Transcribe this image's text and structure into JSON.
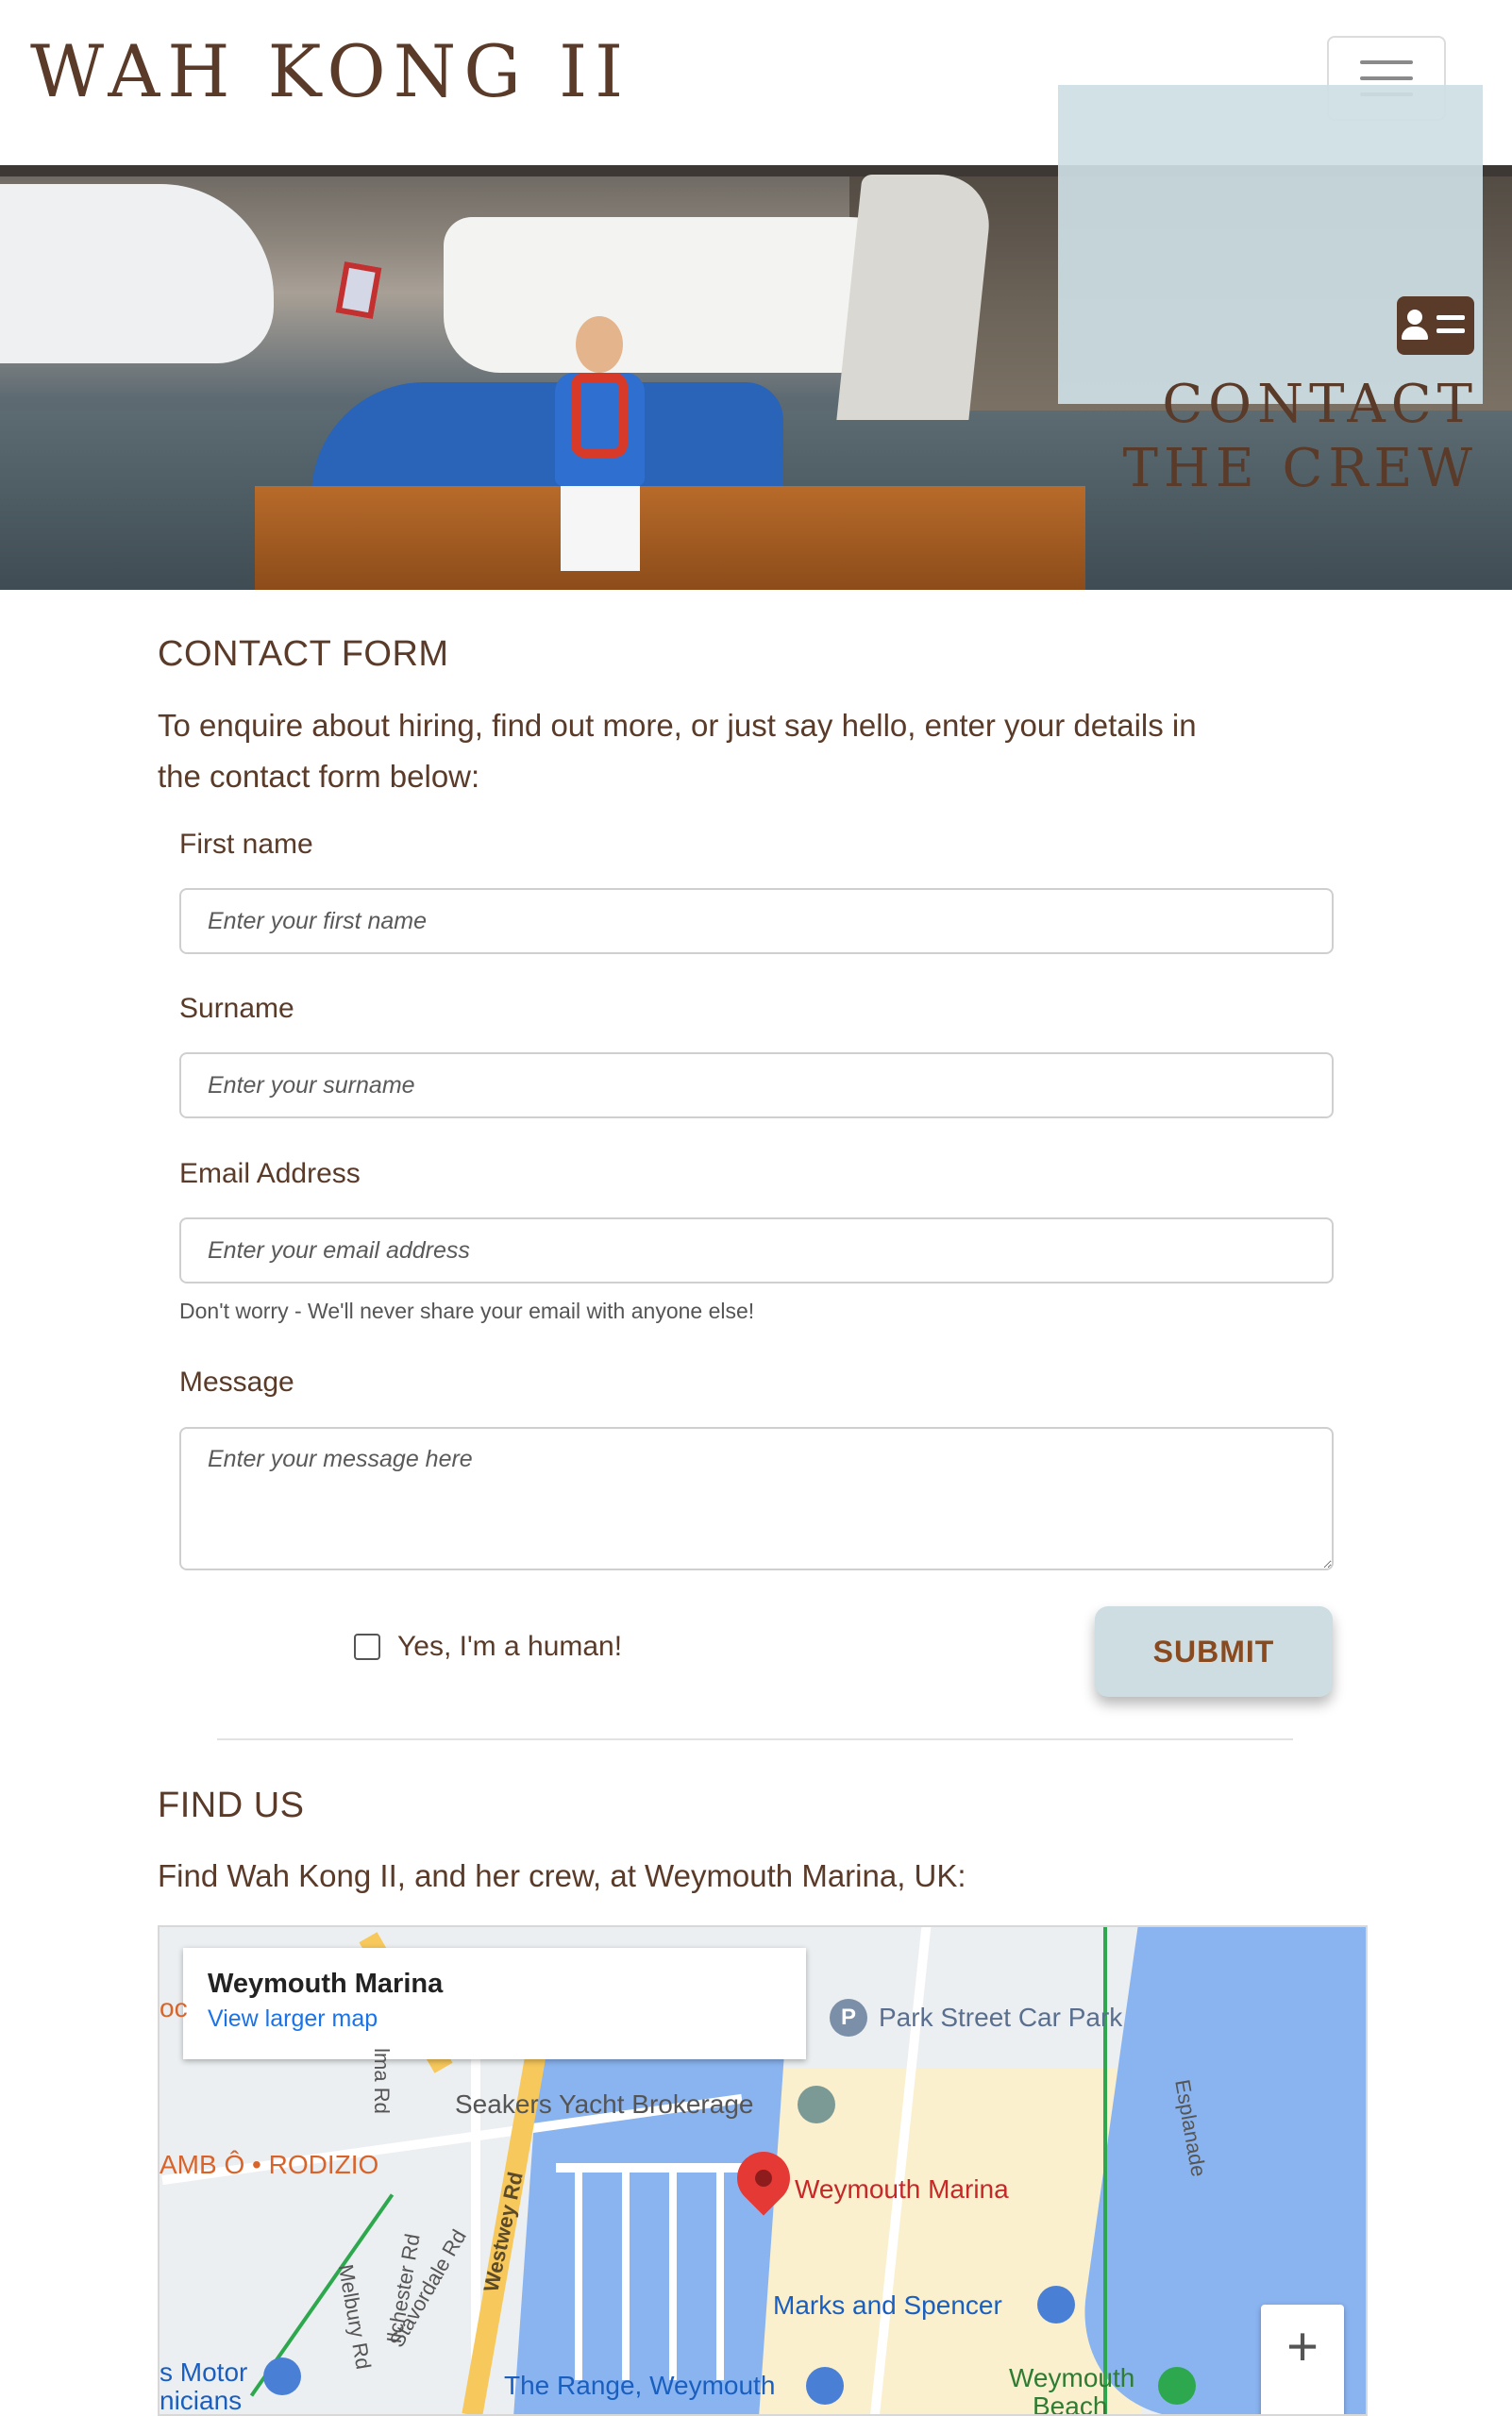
{
  "header": {
    "brand": "WAH KONG II",
    "menu_toggle_icon": "hamburger-icon"
  },
  "hero": {
    "icon": "address-card-icon",
    "title_line1": "CONTACT",
    "title_line2": "THE CREW"
  },
  "contact": {
    "heading": "CONTACT FORM",
    "intro_line1": "To enquire about hiring, find out more, or just say hello, enter your details in",
    "intro_line2": "the contact form below:",
    "fields": {
      "first_name": {
        "label": "First name",
        "placeholder": "Enter your first name",
        "value": ""
      },
      "surname": {
        "label": "Surname",
        "placeholder": "Enter your surname",
        "value": ""
      },
      "email": {
        "label": "Email Address",
        "placeholder": "Enter your email address",
        "value": "",
        "help": "Don't worry - We'll never share your email with anyone else!"
      },
      "message": {
        "label": "Message",
        "placeholder": "Enter your message here",
        "value": ""
      }
    },
    "human_check": {
      "label": "Yes, I'm a human!",
      "checked": false
    },
    "submit_label": "SUBMIT"
  },
  "find_us": {
    "heading": "FIND US",
    "intro": "Find Wah Kong II, and her crew, at Weymouth Marina, UK:",
    "map": {
      "card_title": "Weymouth Marina",
      "card_link": "View larger map",
      "labels": {
        "park_street": "Park Street Car Park",
        "seakers": "Seakers Yacht Brokerage",
        "rodizio": "AMB Ô • RODIZIO",
        "marina": "Weymouth Marina",
        "marks": "Marks and Spencer",
        "range": "The Range, Weymouth",
        "beach_1": "Weymouth",
        "beach_2": "Beach",
        "motor_1": "s Motor",
        "motor_2": "nicians",
        "left_edge": "oc"
      },
      "streets": {
        "alma": "lma Rd",
        "melbury": "Melbury Rd",
        "ilchester": "Ilchester Rd",
        "stavordale": "Stavordale Rd",
        "westwey": "Westwey Rd",
        "esplanade": "Esplanade"
      },
      "poi_parking": "P",
      "zoom_in": "+"
    }
  }
}
